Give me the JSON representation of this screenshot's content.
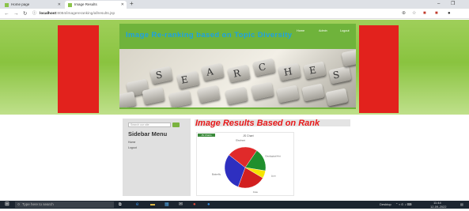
{
  "browser": {
    "tabs": [
      {
        "label": "Home page",
        "active": false
      },
      {
        "label": "Image Results",
        "active": true
      }
    ],
    "new_tab": "+",
    "window_controls": {
      "minimize": "–",
      "maximize": "❐"
    },
    "nav": {
      "back": "←",
      "forward": "→",
      "reload": "↻"
    },
    "url_host": "localhost",
    "url_path": ":8084/imagereranking/allresults.jsp"
  },
  "site": {
    "title": "Image Re-ranking based on Topic Diversity",
    "menu": [
      "Home",
      "Admin",
      "Logout"
    ],
    "banner_letters": [
      "S",
      "E",
      "A",
      "R",
      "C",
      "H",
      "E",
      "S"
    ]
  },
  "sidebar": {
    "search_placeholder": "Search our site",
    "title": "Sidebar Menu",
    "links": [
      "Home",
      "Logout"
    ]
  },
  "results": {
    "title": "Image Results Based on Rank",
    "badge": "JS Charts"
  },
  "chart_data": {
    "type": "pie",
    "title": "JS Chart",
    "slices": [
      {
        "label": "Geological Ant",
        "value": 18,
        "color": "#1f8f2d"
      },
      {
        "label": "Lion",
        "value": 6,
        "color": "#f5e400"
      },
      {
        "label": "Cow",
        "value": 22,
        "color": "#d21f1f"
      },
      {
        "label": "Butterfly",
        "value": 30,
        "color": "#2e2fc0"
      },
      {
        "label": "Elephant",
        "value": 24,
        "color": "#e02a2a"
      }
    ]
  },
  "taskbar": {
    "search_placeholder": "Type here to search",
    "desktop_label": "Desktop",
    "time": "11:44",
    "date": "12-09-2022",
    "colors": {
      "start": "#ffffff",
      "bar": "#1c2530"
    }
  },
  "colors": {
    "header_green": "#6fb33b",
    "side_red": "#e2221d",
    "title_blue": "#1da1e2",
    "results_red": "#e8191a"
  }
}
